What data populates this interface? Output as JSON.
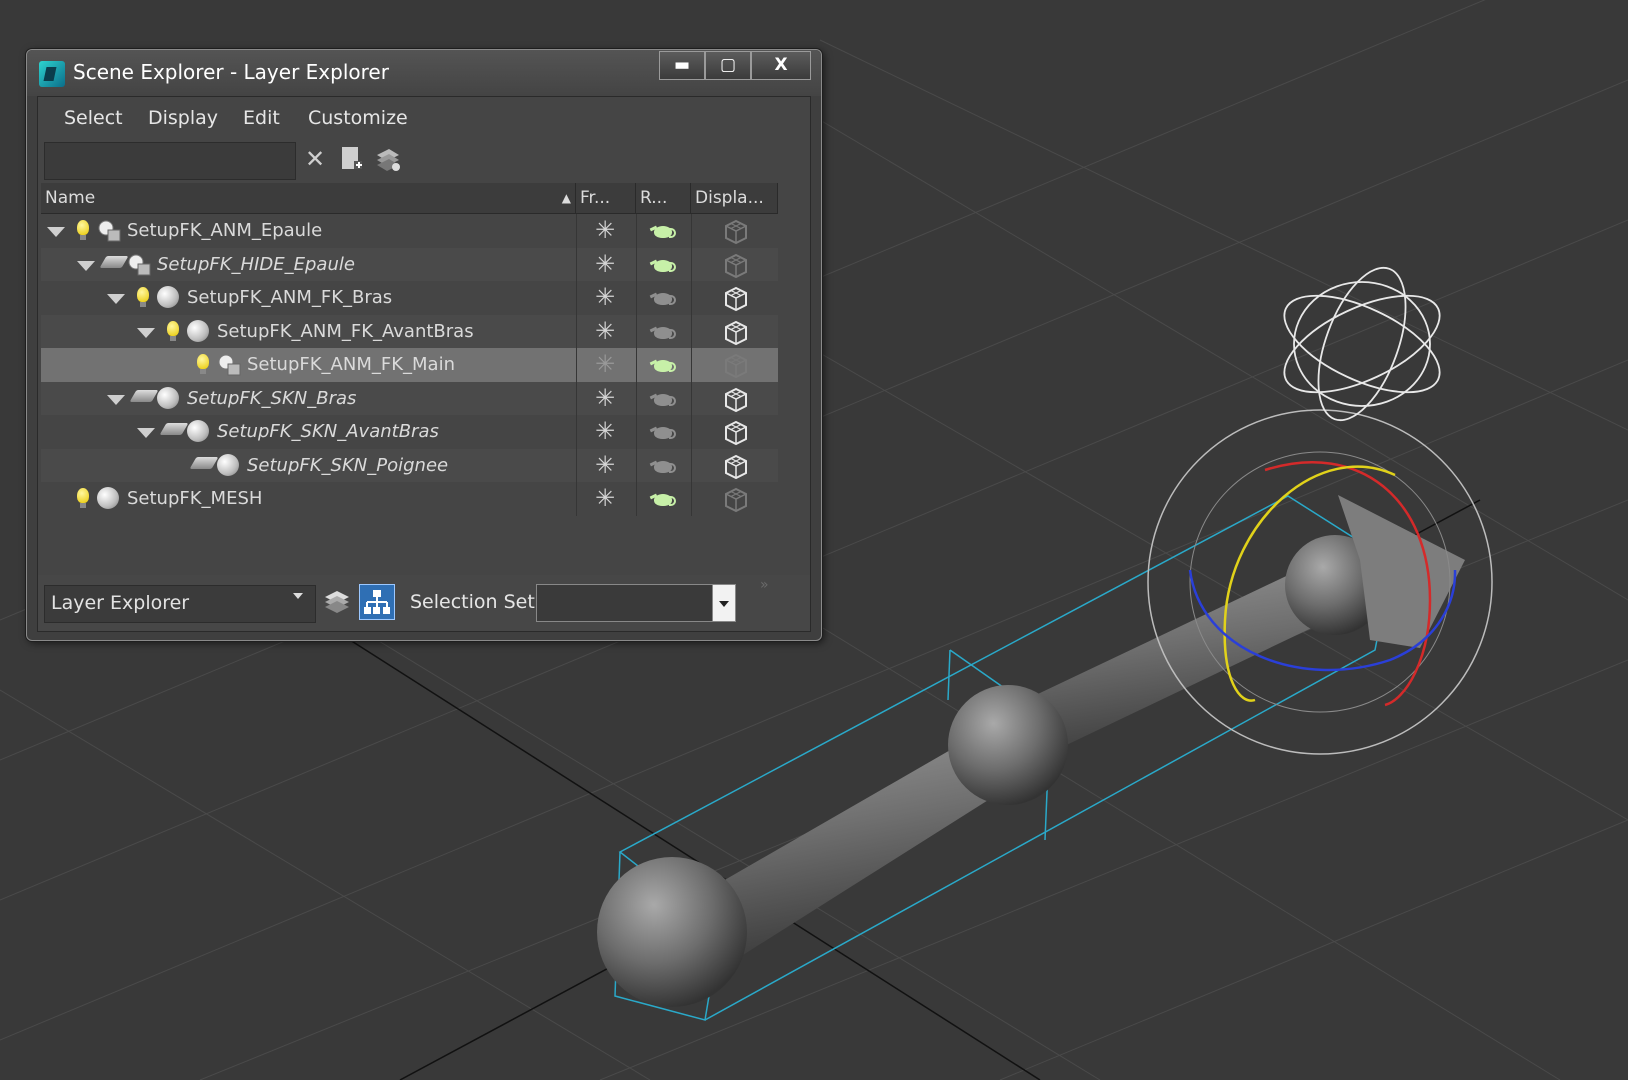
{
  "window": {
    "title": "Scene Explorer - Layer Explorer",
    "controls": {
      "minimize": "▬",
      "maximize": "▢",
      "close": "X"
    }
  },
  "menu": [
    "Select",
    "Display",
    "Edit",
    "Customize"
  ],
  "toolbar": {
    "search_value": "",
    "clear_glyph": "✕"
  },
  "columns": {
    "name": "Name",
    "freeze": "Fr...",
    "render": "R...",
    "display": "Displa..."
  },
  "rows": [
    {
      "label": "SetupFK_ANM_Epaule",
      "italic": false
    },
    {
      "label": "SetupFK_HIDE_Epaule",
      "italic": true
    },
    {
      "label": "SetupFK_ANM_FK_Bras",
      "italic": false
    },
    {
      "label": "SetupFK_ANM_FK_AvantBras",
      "italic": false
    },
    {
      "label": "SetupFK_ANM_FK_Main",
      "italic": false,
      "selected": true
    },
    {
      "label": "SetupFK_SKN_Bras",
      "italic": true
    },
    {
      "label": "SetupFK_SKN_AvantBras",
      "italic": true
    },
    {
      "label": "SetupFK_SKN_Poignee",
      "italic": true
    },
    {
      "label": "SetupFK_MESH",
      "italic": false
    }
  ],
  "status": {
    "explorer_name": "Layer Explorer",
    "selection_set_label": "Selection Set:",
    "selection_set_value": "",
    "overflow_glyph": "»"
  },
  "glyphs": {
    "freeze": "✳",
    "sort_up": "▲"
  },
  "colors": {
    "teapot_active": "#c7f0a8",
    "teapot_inactive": "#8f8f8f",
    "gizmo_x": "#d42a2a",
    "gizmo_y": "#e1d21a",
    "gizmo_z": "#2a3fd8",
    "bbox": "#2aa9c9"
  }
}
